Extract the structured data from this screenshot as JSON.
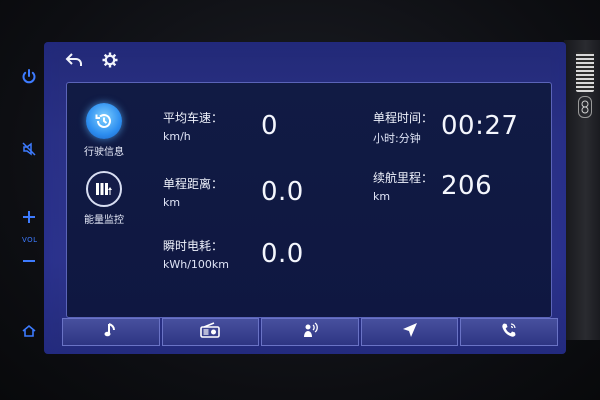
{
  "hardware": {
    "vol_label": "VOL",
    "icons": [
      "power-icon",
      "mute-icon",
      "volume-up-icon",
      "volume-down-icon",
      "home-icon"
    ]
  },
  "topbar": {
    "icons": [
      "back-arrow-icon",
      "gear-icon"
    ]
  },
  "sidebar": {
    "items": [
      {
        "label": "行驶信息",
        "icon": "history-clock-icon",
        "active": true
      },
      {
        "label": "能量监控",
        "icon": "battery-bars-icon",
        "active": false
      }
    ]
  },
  "metrics": {
    "avg_speed": {
      "name": "平均车速：",
      "unit": "km/h",
      "value": "0"
    },
    "trip_distance": {
      "name": "单程距离：",
      "unit": "km",
      "value": "0.0"
    },
    "instant_consumption": {
      "name": "瞬时电耗：",
      "unit": "kWh/100km",
      "value": "0.0"
    },
    "trip_time": {
      "name": "单程时间：",
      "unit": "小时:分钟",
      "value": "00:27"
    },
    "range": {
      "name": "续航里程：",
      "unit": "km",
      "value": "206"
    }
  },
  "dock": {
    "items": [
      "music-note-icon",
      "radio-icon",
      "voice-assistant-icon",
      "navigation-arrow-icon",
      "phone-icon"
    ]
  },
  "colors": {
    "accent": "#3d7bff",
    "screen_bg": "#2a3186",
    "panel_bg": "#111b44"
  }
}
